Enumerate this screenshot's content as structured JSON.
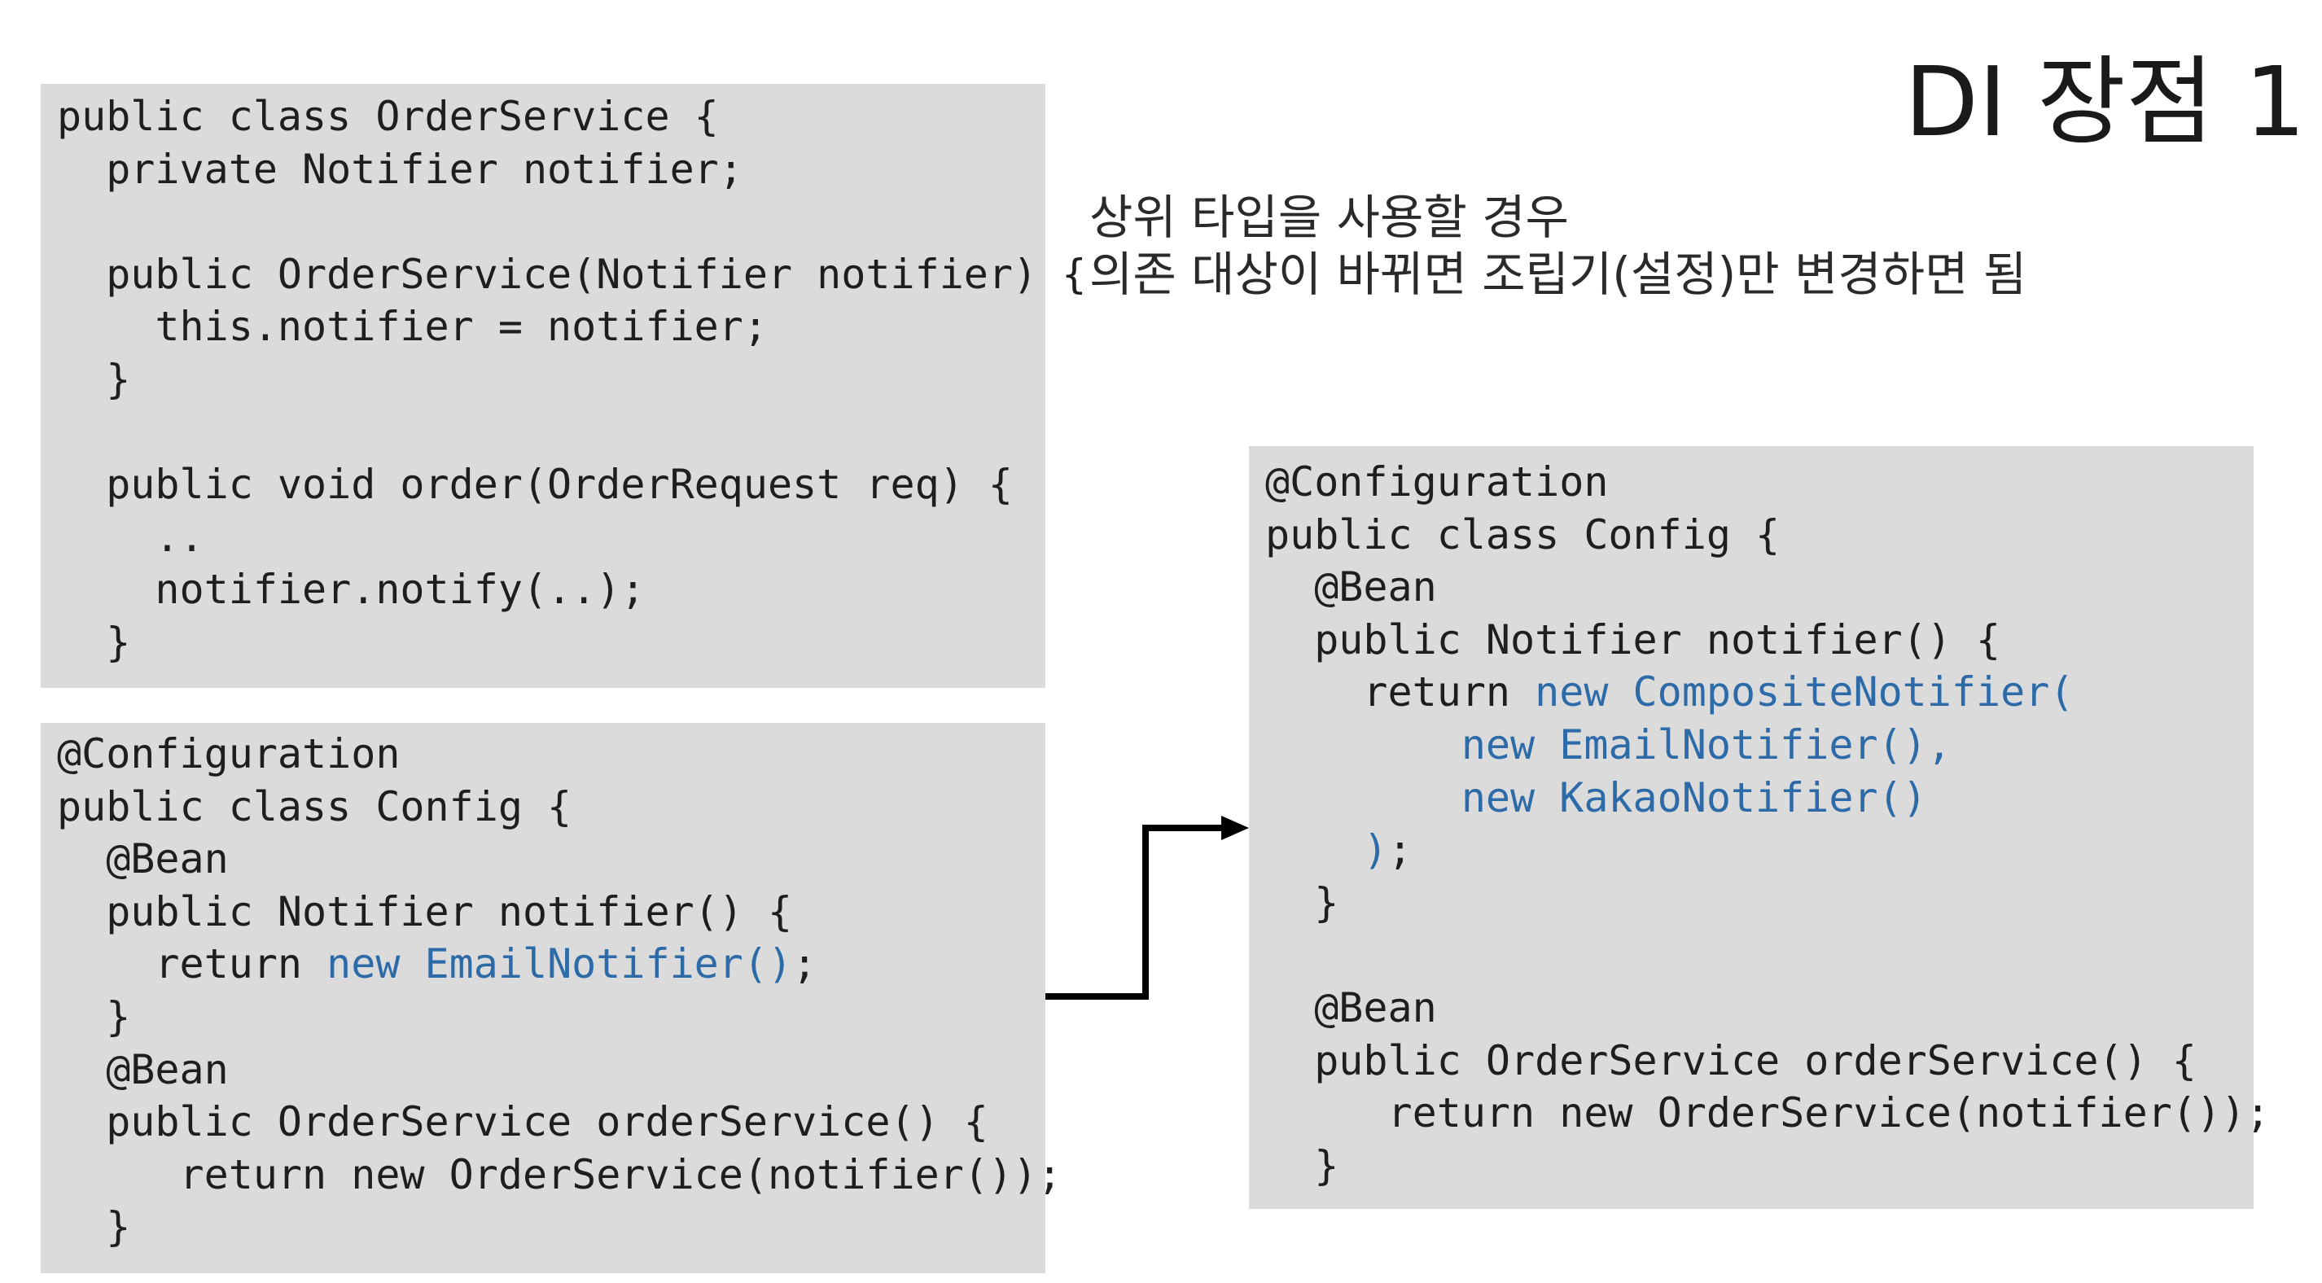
{
  "title": "DI 장점 1",
  "description": {
    "line1": "상위 타입을 사용할 경우",
    "line2": "의존 대상이 바뀌면 조립기(설정)만 변경하면 됨"
  },
  "colors": {
    "code_background": "#dbdbdb",
    "highlight": "#2c6aa8",
    "arrow": "#000000"
  },
  "order_service_code": {
    "line1": "public class OrderService {",
    "line2": "  private Notifier notifier;",
    "line3": "",
    "line4": "  public OrderService(Notifier notifier) {",
    "line5": "    this.notifier = notifier;",
    "line6": "  }",
    "line7": "",
    "line8": "  public void order(OrderRequest req) {",
    "line9": "    ..",
    "line10": "    notifier.notify(..);",
    "line11": "  }"
  },
  "config_before": {
    "line1": "@Configuration",
    "line2": "public class Config {",
    "line3": "  @Bean",
    "line4": "  public Notifier notifier() {",
    "line5_prefix": "    return ",
    "line5_highlight": "new EmailNotifier()",
    "line5_suffix": ";",
    "line6": "  }",
    "line7": "  @Bean",
    "line8": "  public OrderService orderService() {",
    "line9": "     return new OrderService(notifier());",
    "line10": "  }"
  },
  "config_after": {
    "line1": "@Configuration",
    "line2": "public class Config {",
    "line3": "  @Bean",
    "line4": "  public Notifier notifier() {",
    "line5_prefix": "    return ",
    "line5_highlight": "new CompositeNotifier(",
    "line6_prefix": "        ",
    "line6_highlight": "new EmailNotifier(),",
    "line7_prefix": "        ",
    "line7_highlight": "new KakaoNotifier()",
    "line8_prefix": "    ",
    "line8_highlight": ")",
    "line8_suffix": ";",
    "line9": "  }",
    "line10": "",
    "line11": "  @Bean",
    "line12": "  public OrderService orderService() {",
    "line13": "     return new OrderService(notifier());",
    "line14": "  }"
  }
}
